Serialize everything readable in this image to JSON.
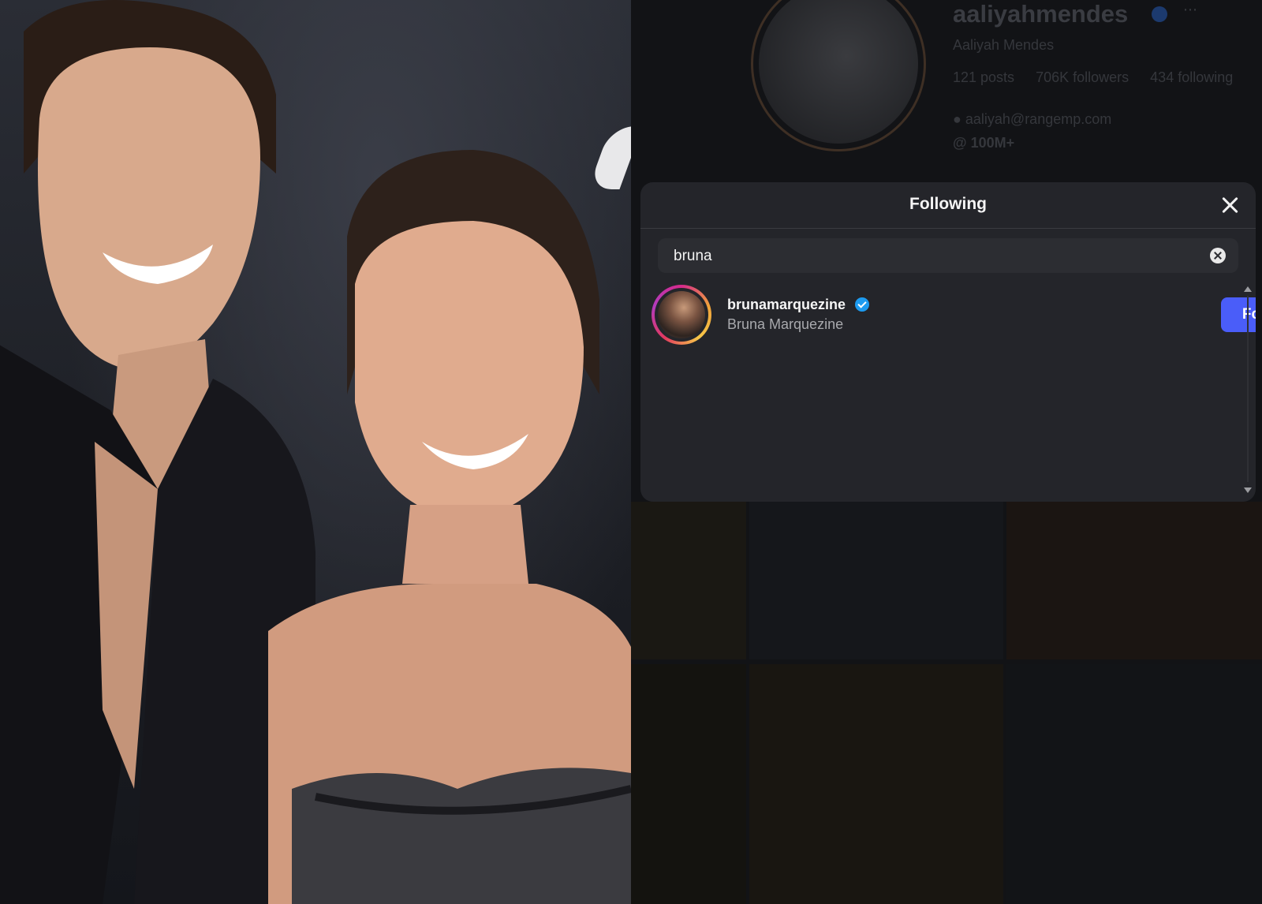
{
  "profile": {
    "handle": "aaliyahmendes",
    "full_name": "Aaliyah Mendes",
    "posts": "121 posts",
    "followers": "706K followers",
    "following": "434 following",
    "email": "aaliyah@rangemp.com",
    "threads": "100M+"
  },
  "modal": {
    "title": "Following",
    "search_value": "bruna",
    "results": [
      {
        "username": "brunamarquezine",
        "display_name": "Bruna Marquezine",
        "verified": true,
        "action_label": "Follow"
      }
    ]
  },
  "colors": {
    "follow_button": "#4a5df9",
    "modal_bg": "#24252a",
    "verified_badge": "#1d9bf0"
  }
}
